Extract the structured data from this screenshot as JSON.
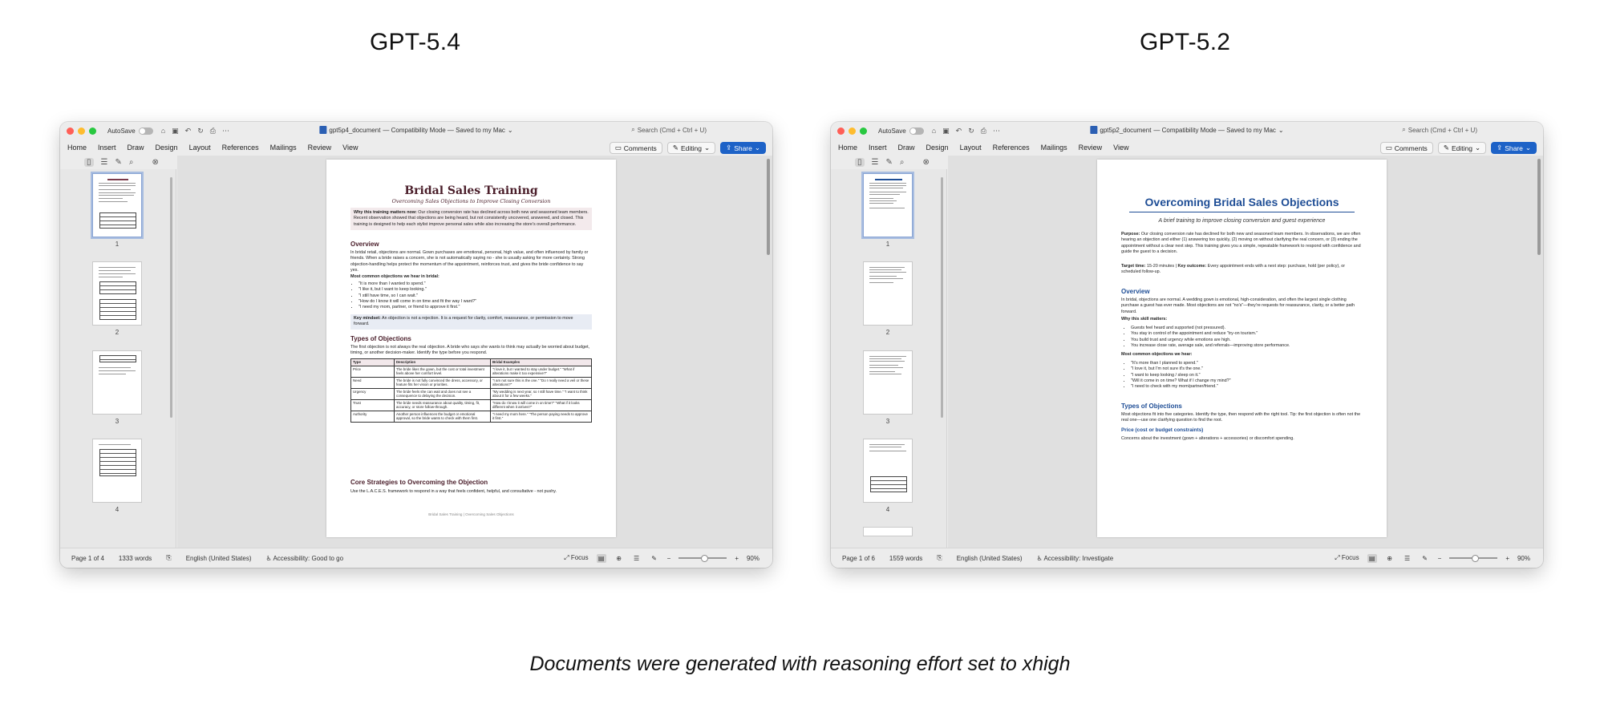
{
  "headings": {
    "left": "GPT-5.4",
    "right": "GPT-5.2"
  },
  "caption": "Documents were generated with reasoning effort set to xhigh",
  "common": {
    "autosave": "AutoSave",
    "mode_suffix": "— Compatibility Mode — Saved to my Mac",
    "search": "Search (Cmd + Ctrl + U)",
    "tabs": [
      "Home",
      "Insert",
      "Draw",
      "Design",
      "Layout",
      "References",
      "Mailings",
      "Review",
      "View"
    ],
    "comments": "Comments",
    "editing": "Editing",
    "share": "Share",
    "language": "English (United States)",
    "focus": "Focus",
    "zoom": "90%",
    "icons": [
      "red-close",
      "minimize",
      "maximize",
      "home-icon",
      "save-icon",
      "undo-icon",
      "redo-icon",
      "print-icon",
      "more-icon",
      "search-icon",
      "chevron-down-icon"
    ]
  },
  "left_window": {
    "filename": "gpt5p4_document",
    "status": {
      "page": "Page 1 of 4",
      "words": "1333 words",
      "accessibility": "Accessibility: Good to go"
    },
    "thumb_labels": [
      "1",
      "2",
      "3",
      "4"
    ],
    "doc": {
      "title": "Bridal Sales Training",
      "subtitle": "Overcoming Sales Objections to Improve Closing Conversion",
      "why_label": "Why this training matters now:",
      "why_text": " Our closing conversion rate has declined across both new and seasoned team members. Recent observation showed that objections are being heard, but not consistently uncovered, answered, and closed. This training is designed to help each stylist improve personal sales while also increasing the store's overall performance.",
      "overview_heading": "Overview",
      "overview_text": "In bridal retail, objections are normal. Gown purchases are emotional, personal, high value, and often influenced by family or friends. When a bride raises a concern, she is not automatically saying no - she is usually asking for more certainty. Strong objection-handling helps protect the momentum of the appointment, reinforces trust, and gives the bride confidence to say yes.",
      "common_label": "Most common objections we hear in bridal:",
      "objections": [
        "\"It is more than I wanted to spend.\"",
        "\"I like it, but I want to keep looking.\"",
        "\"I still have time, so I can wait.\"",
        "\"How do I know it will come in on time and fit the way I want?\"",
        "\"I need my mom, partner, or friend to approve it first.\""
      ],
      "mindset_label": "Key mindset:",
      "mindset_text": " An objection is not a rejection. It is a request for clarity, comfort, reassurance, or permission to move forward.",
      "types_heading": "Types of Objections",
      "types_text": "The first objection is not always the real objection. A bride who says she wants to think may actually be worried about budget, timing, or another decision-maker. Identify the type before you respond.",
      "table_headers": [
        "Type",
        "Description",
        "Bridal Examples"
      ],
      "table_rows": [
        [
          "Price",
          "The bride likes the gown, but the cost or total investment feels above her comfort level.",
          "\"I love it, but I wanted to stay under budget.\" \"What if alterations make it too expensive?\""
        ],
        [
          "Need",
          "The bride is not fully convinced the dress, accessory, or feature fits her vision or priorities.",
          "\"I am not sure this is the one.\" \"Do I really need a veil or these alterations?\""
        ],
        [
          "Urgency",
          "The bride feels she can wait and does not see a consequence to delaying the decision.",
          "\"My wedding is next year, so I still have time.\" \"I want to think about it for a few weeks.\""
        ],
        [
          "Trust",
          "The bride needs reassurance about quality, timing, fit, accuracy, or store follow-through.",
          "\"How do I know it will come in on time?\" \"What if it looks different when it arrives?\""
        ],
        [
          "Authority",
          "Another person influences the budget or emotional approval, so the bride wants to check with them first.",
          "\"I need my mom here.\" \"The person paying needs to approve it first.\""
        ]
      ],
      "core_heading": "Core Strategies to Overcoming the Objection",
      "core_text": "Use the L.A.C.E.S. framework to respond in a way that feels confident, helpful, and consultative - not pushy.",
      "footer": "Bridal Sales Training | Overcoming Sales Objections"
    }
  },
  "right_window": {
    "filename": "gpt5p2_document",
    "status": {
      "page": "Page 1 of 6",
      "words": "1559 words",
      "accessibility": "Accessibility: Investigate"
    },
    "thumb_labels": [
      "1",
      "2",
      "3",
      "4"
    ],
    "doc": {
      "title": "Overcoming Bridal Sales Objections",
      "subtitle": "A brief training to improve closing conversion and guest experience",
      "purpose_label": "Purpose:",
      "purpose_text": " Our closing conversion rate has declined for both new and seasoned team members. In observations, we are often hearing an objection and either (1) answering too quickly, (2) moving on without clarifying the real concern, or (3) ending the appointment without a clear next step. This training gives you a simple, repeatable framework to respond with confidence and guide the guest to a decision.",
      "target_label": "Target time:",
      "target_text": " 15-20 minutes  |  ",
      "outcome_label": "Key outcome:",
      "outcome_text": " Every appointment ends with a next step: purchase, hold (per policy), or scheduled follow-up.",
      "overview_heading": "Overview",
      "overview_text": "In bridal, objections are normal. A wedding gown is emotional, high-consideration, and often the largest single clothing purchase a guest has ever made. Most objections are not \"no's\"—they're requests for reassurance, clarity, or a better path forward.",
      "why_label": "Why this skill matters:",
      "why_items": [
        "Guests feel heard and supported (not pressured).",
        "You stay in control of the appointment and reduce \"try-on tourism.\"",
        "You build trust and urgency while emotions are high.",
        "You increase close rate, average sale, and referrals—improving store performance."
      ],
      "common_label": "Most common objections we hear:",
      "objections": [
        "\"It's more than I planned to spend.\"",
        "\"I love it, but I'm not sure it's the one.\"",
        "\"I want to keep looking / sleep on it.\"",
        "\"Will it come in on time? What if I change my mind?\"",
        "\"I need to check with my mom/partner/friend.\""
      ],
      "types_heading": "Types of Objections",
      "types_text": "Most objections fit into five categories. Identify the type, then respond with the right tool. Tip: the first objection is often not the real one—use one clarifying question to find the root.",
      "price_heading": "Price (cost or budget constraints)",
      "price_text": "Concerns about the investment (gown + alterations + accessories) or discomfort spending."
    }
  }
}
